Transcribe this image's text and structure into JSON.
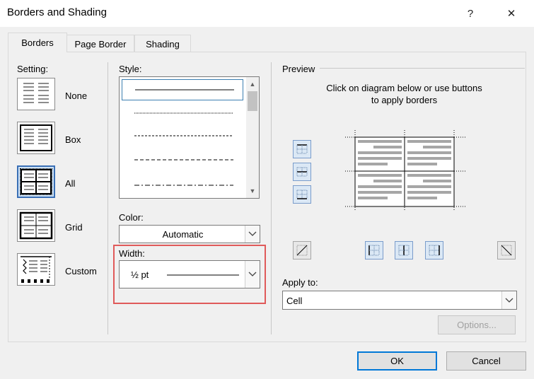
{
  "window": {
    "title": "Borders and Shading",
    "help": "?",
    "close": "✕"
  },
  "tabs": [
    {
      "label": "Borders",
      "active": true
    },
    {
      "label": "Page Border",
      "active": false
    },
    {
      "label": "Shading",
      "active": false
    }
  ],
  "setting": {
    "label": "Setting:",
    "options": [
      {
        "label": "None",
        "selected": false
      },
      {
        "label": "Box",
        "selected": false
      },
      {
        "label": "All",
        "selected": true
      },
      {
        "label": "Grid",
        "selected": false
      },
      {
        "label": "Custom",
        "selected": false
      }
    ]
  },
  "style": {
    "label": "Style:",
    "items": [
      "solid",
      "dotted",
      "small-dash",
      "dash",
      "dash-dot"
    ],
    "selected": "solid"
  },
  "color": {
    "label": "Color:",
    "value": "Automatic"
  },
  "width": {
    "label": "Width:",
    "value": "½ pt"
  },
  "preview": {
    "label": "Preview",
    "instruction_line1": "Click on diagram below or use buttons",
    "instruction_line2": "to apply borders"
  },
  "apply_to": {
    "label": "Apply to:",
    "value": "Cell"
  },
  "options_button": "Options...",
  "ok_button": "OK",
  "cancel_button": "Cancel",
  "colors": {
    "highlight": "#e05a5a",
    "accent": "#0078d7"
  }
}
